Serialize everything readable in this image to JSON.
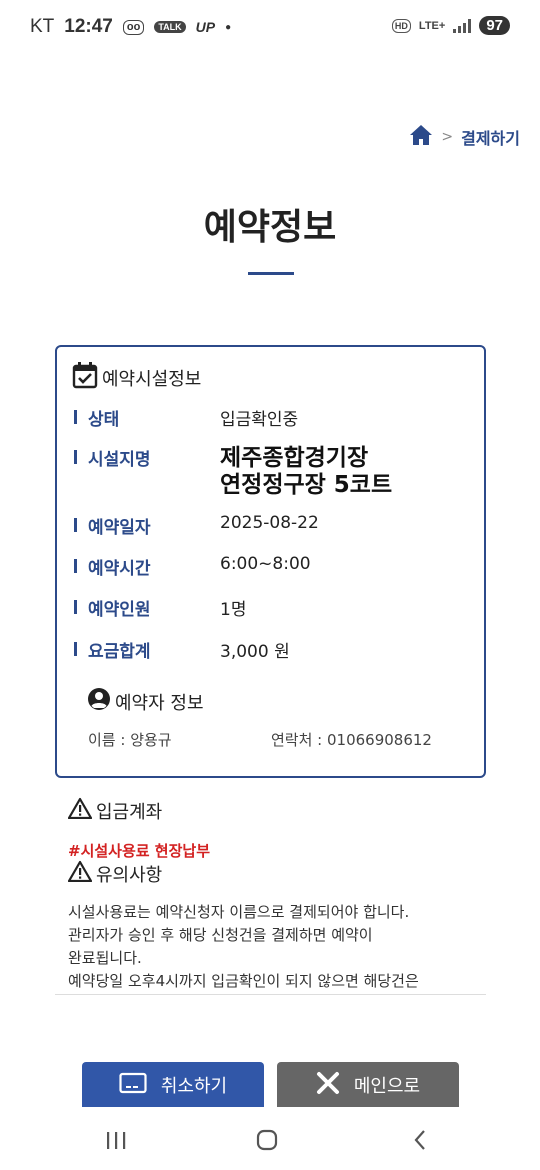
{
  "status_bar": {
    "carrier": "KT",
    "time": "12:47",
    "talk_badge": "TALK",
    "up_label": "UP",
    "hd_badge": "HD",
    "network": "LTE+",
    "battery": "97",
    "icons": [
      "voicemail-icon",
      "talk-icon",
      "signal-icon",
      "battery-icon"
    ]
  },
  "breadcrumb": {
    "home_icon": "home-icon",
    "separator": ">",
    "current": "결제하기"
  },
  "title": "예약정보",
  "facility_section": {
    "heading": "예약시설정보",
    "icon": "calendar-check-icon",
    "rows": [
      {
        "label": "상태",
        "value": "입금확인중"
      },
      {
        "label": "시설지명",
        "value_line1": "제주종합경기장",
        "value_line2": "연정정구장 5코트"
      },
      {
        "label": "예약일자",
        "value": "2025-08-22"
      },
      {
        "label": "예약시간",
        "value": "6:00~8:00"
      },
      {
        "label": "예약인원",
        "value": "1명"
      },
      {
        "label": "요금합계",
        "value": "3,000 원"
      }
    ]
  },
  "booker_section": {
    "heading": "예약자 정보",
    "icon": "user-circle-icon",
    "name_label": "이름 : 양용규",
    "contact_label": "연락처 : 01066908612"
  },
  "deposit_section": {
    "heading": "입금계좌",
    "icon": "warning-icon",
    "note": "#시설사용료 현장납부"
  },
  "caution_section": {
    "heading": "유의사항",
    "icon": "warning-icon",
    "lines": [
      "시설사용료는 예약신청자 이름으로 결제되어야 합니다.",
      "관리자가 승인 후 해당 신청건을 결제하면 예약이",
      "완료됩니다.",
      "예약당일 오후4시까지 입금확인이 되지 않으면 해당건은"
    ]
  },
  "buttons": {
    "cancel_label": "취소하기",
    "cancel_icon": "card-icon",
    "main_label": "메인으로",
    "main_icon": "close-icon"
  },
  "nav": {
    "recents_icon": "recents-icon",
    "home_icon": "home-circle-icon",
    "back_icon": "back-chevron-icon"
  },
  "colors": {
    "brand": "#2c4a8a",
    "cancel_button": "#3157a8",
    "main_button": "#666666",
    "note_red": "#d32222"
  }
}
